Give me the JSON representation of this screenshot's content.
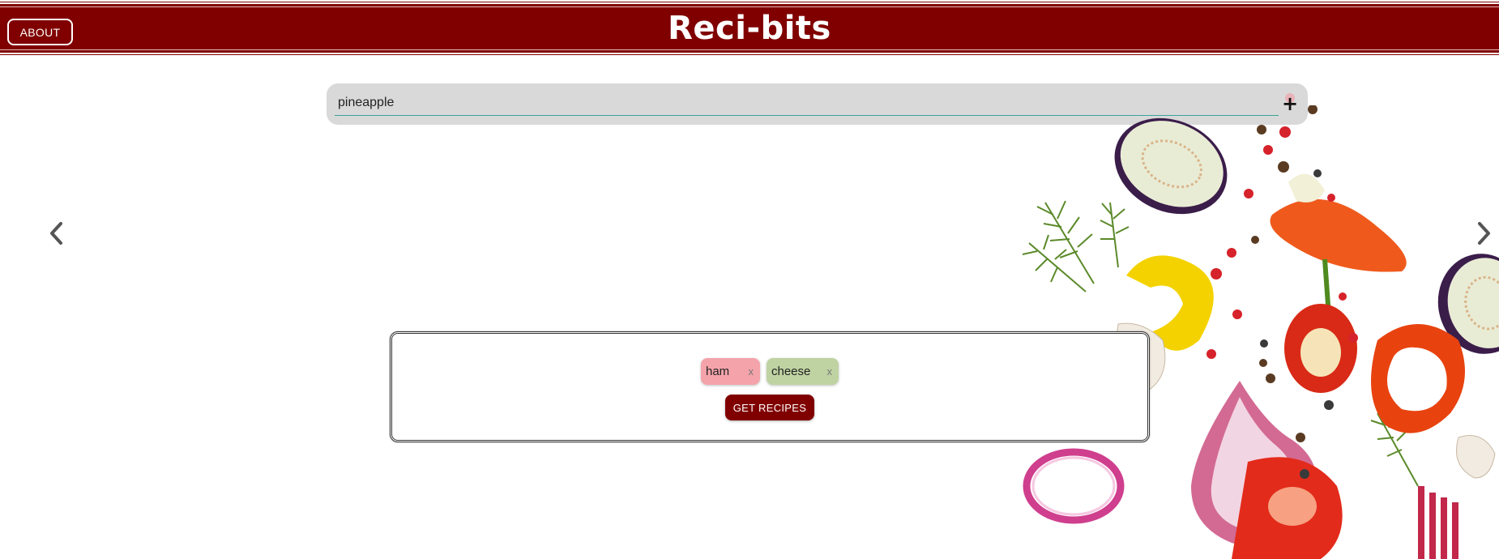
{
  "header": {
    "about_label": "ABOUT",
    "brand": "Reci-bits"
  },
  "search": {
    "value": "pineapple",
    "placeholder": "",
    "add_icon": "plus-icon"
  },
  "carousel": {
    "prev_icon": "chevron-left-icon",
    "next_icon": "chevron-right-icon"
  },
  "ingredients": {
    "chips": [
      {
        "label": "ham",
        "remove": "x",
        "color": "#f4a3aa"
      },
      {
        "label": "cheese",
        "remove": "x",
        "color": "#bfd3a2"
      }
    ],
    "get_recipes_label": "GET RECIPES"
  },
  "colors": {
    "brand": "#800000",
    "search_bg": "#d9d9d9",
    "search_underline": "#3aa39a"
  }
}
